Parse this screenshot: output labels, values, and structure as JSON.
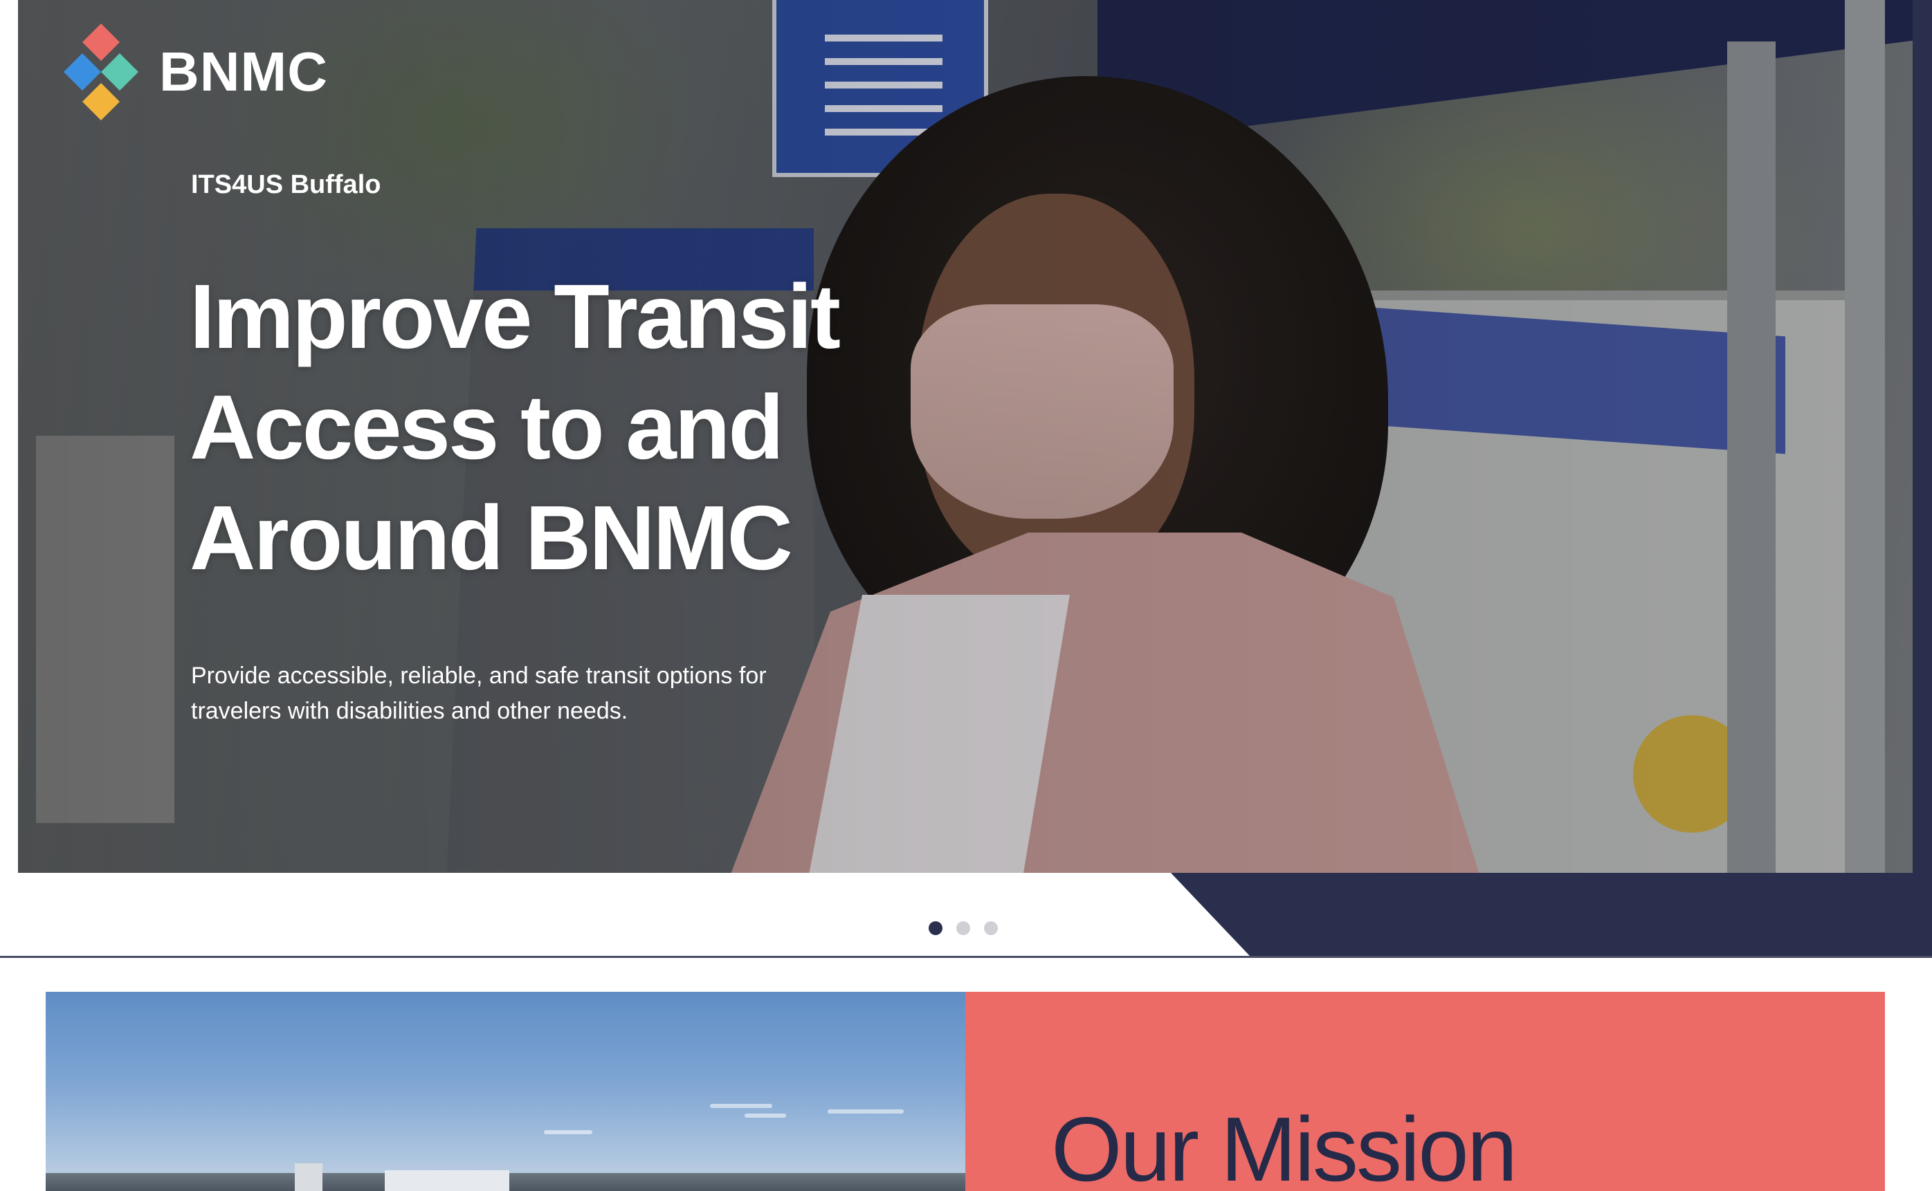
{
  "brand": {
    "name": "BNMC",
    "logo_icon": "diamond-cluster-logo",
    "logo_colors": [
      "#ec6b66",
      "#3b8fe0",
      "#5cc9b0",
      "#f3b43c"
    ]
  },
  "hero": {
    "eyebrow": "ITS4US Buffalo",
    "headline_lines": [
      "Improve Transit",
      "Access to and",
      "Around BNMC"
    ],
    "description": "Provide accessible, reliable, and safe transit options for travelers with disabilities and other needs.",
    "image_description": "",
    "carousel": {
      "slide_count": 3,
      "active_index": 0
    }
  },
  "mission": {
    "title": "Our Mission"
  },
  "colors": {
    "navy": "#2b2f4e",
    "coral": "#ec6b66",
    "dot_inactive": "#cfd0d3",
    "white": "#ffffff"
  }
}
